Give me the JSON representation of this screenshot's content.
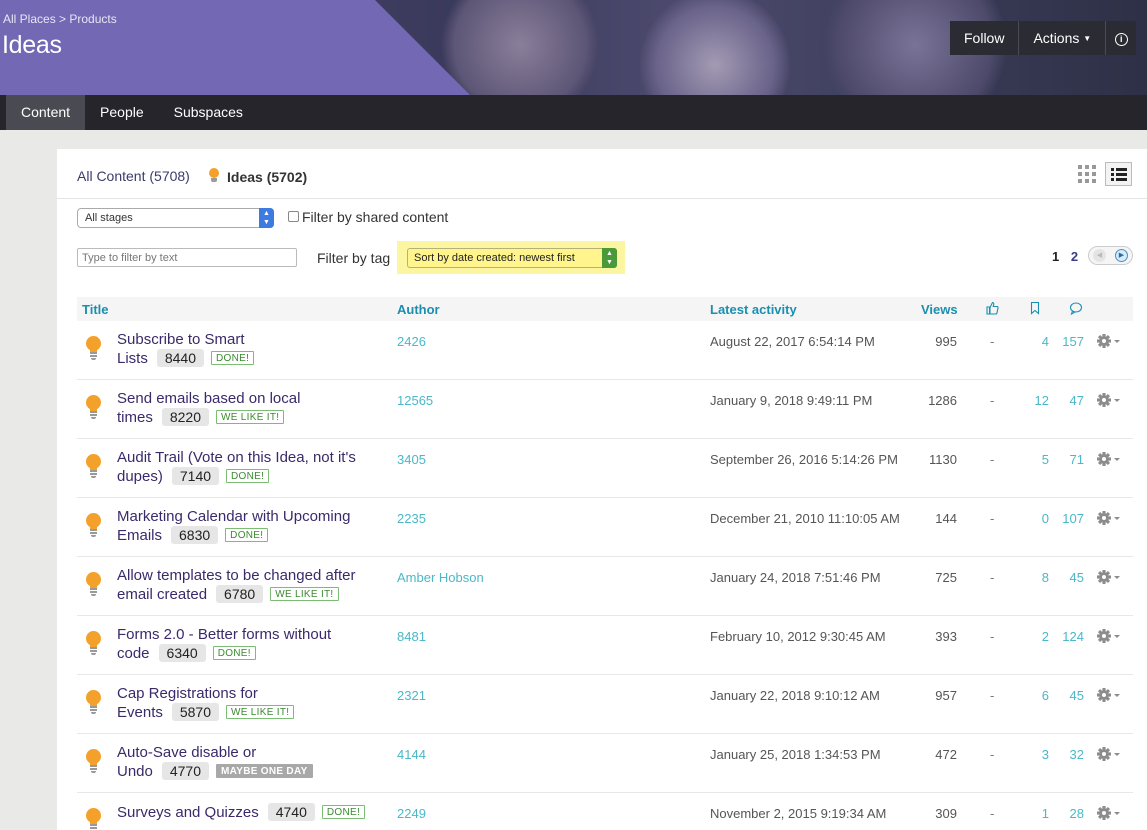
{
  "header": {
    "breadcrumb": "All Places > Products",
    "title": "Ideas",
    "follow_label": "Follow",
    "actions_label": "Actions",
    "info_glyph": "i"
  },
  "nav": {
    "tabs": [
      {
        "label": "Content"
      },
      {
        "label": "People"
      },
      {
        "label": "Subspaces"
      }
    ]
  },
  "content_tabs": {
    "all": "All Content (5708)",
    "ideas": "Ideas (5702)"
  },
  "filters": {
    "stage_value": "All stages",
    "shared_label": "Filter by shared content",
    "text_placeholder": "Type to filter by text",
    "tag_label": "Filter by tag",
    "sort_value": "Sort by date created: newest first"
  },
  "pager": {
    "page1": "1",
    "page2": "2"
  },
  "table": {
    "headers": {
      "title": "Title",
      "author": "Author",
      "latest": "Latest activity",
      "views": "Views"
    },
    "header_icons": [
      "thumbs-up-icon",
      "bookmark-icon",
      "comment-icon"
    ],
    "rows": [
      {
        "title1": "Subscribe to Smart",
        "title2": "Lists",
        "votes": "8440",
        "badge": "DONE!",
        "badge_style": "green",
        "author": "2426",
        "latest": "August 22, 2017 6:54:14 PM",
        "views": "995",
        "likes": "-",
        "bookmarks": "4",
        "comments": "157"
      },
      {
        "title1": "Send emails based on local",
        "title2": "times",
        "votes": "8220",
        "badge": "WE LIKE IT!",
        "badge_style": "green",
        "author": "12565",
        "latest": "January 9, 2018 9:49:11 PM",
        "views": "1286",
        "likes": "-",
        "bookmarks": "12",
        "comments": "47"
      },
      {
        "title1": "Audit Trail (Vote on this Idea, not it's",
        "title2": "dupes)",
        "votes": "7140",
        "badge": "DONE!",
        "badge_style": "green",
        "author": "3405",
        "latest": "September 26, 2016 5:14:26 PM",
        "views": "1130",
        "likes": "-",
        "bookmarks": "5",
        "comments": "71"
      },
      {
        "title1": "Marketing Calendar with Upcoming",
        "title2": "Emails",
        "votes": "6830",
        "badge": "DONE!",
        "badge_style": "green",
        "author": "2235",
        "latest": "December 21, 2010 11:10:05 AM",
        "views": "144",
        "likes": "-",
        "bookmarks": "0",
        "comments": "107"
      },
      {
        "title1": "Allow templates to be changed after",
        "title2": "email created",
        "votes": "6780",
        "badge": "WE LIKE IT!",
        "badge_style": "green",
        "author": "Amber Hobson",
        "latest": "January 24, 2018 7:51:46 PM",
        "views": "725",
        "likes": "-",
        "bookmarks": "8",
        "comments": "45"
      },
      {
        "title1": "Forms 2.0 - Better forms without",
        "title2": "code",
        "votes": "6340",
        "badge": "DONE!",
        "badge_style": "green",
        "author": "8481",
        "latest": "February 10, 2012 9:30:45 AM",
        "views": "393",
        "likes": "-",
        "bookmarks": "2",
        "comments": "124"
      },
      {
        "title1": "Cap Registrations for",
        "title2": "Events",
        "votes": "5870",
        "badge": "WE LIKE IT!",
        "badge_style": "green",
        "author": "2321",
        "latest": "January 22, 2018 9:10:12 AM",
        "views": "957",
        "likes": "-",
        "bookmarks": "6",
        "comments": "45"
      },
      {
        "title1": "Auto-Save disable or",
        "title2": "Undo",
        "votes": "4770",
        "badge": "MAYBE ONE DAY",
        "badge_style": "gray",
        "author": "4144",
        "latest": "January 25, 2018 1:34:53 PM",
        "views": "472",
        "likes": "-",
        "bookmarks": "3",
        "comments": "32"
      },
      {
        "title1": "Surveys and Quizzes",
        "title2": "",
        "votes": "4740",
        "badge": "DONE!",
        "badge_style": "green",
        "author": "2249",
        "latest": "November 2, 2015 9:19:34 AM",
        "views": "309",
        "likes": "-",
        "bookmarks": "1",
        "comments": "28"
      }
    ]
  },
  "colors": {
    "accent": "#7268b4",
    "link": "#4ab8c8",
    "header_link": "#1a8fb0",
    "bulb": "#f4a12b",
    "highlight": "#fdf6a0"
  }
}
